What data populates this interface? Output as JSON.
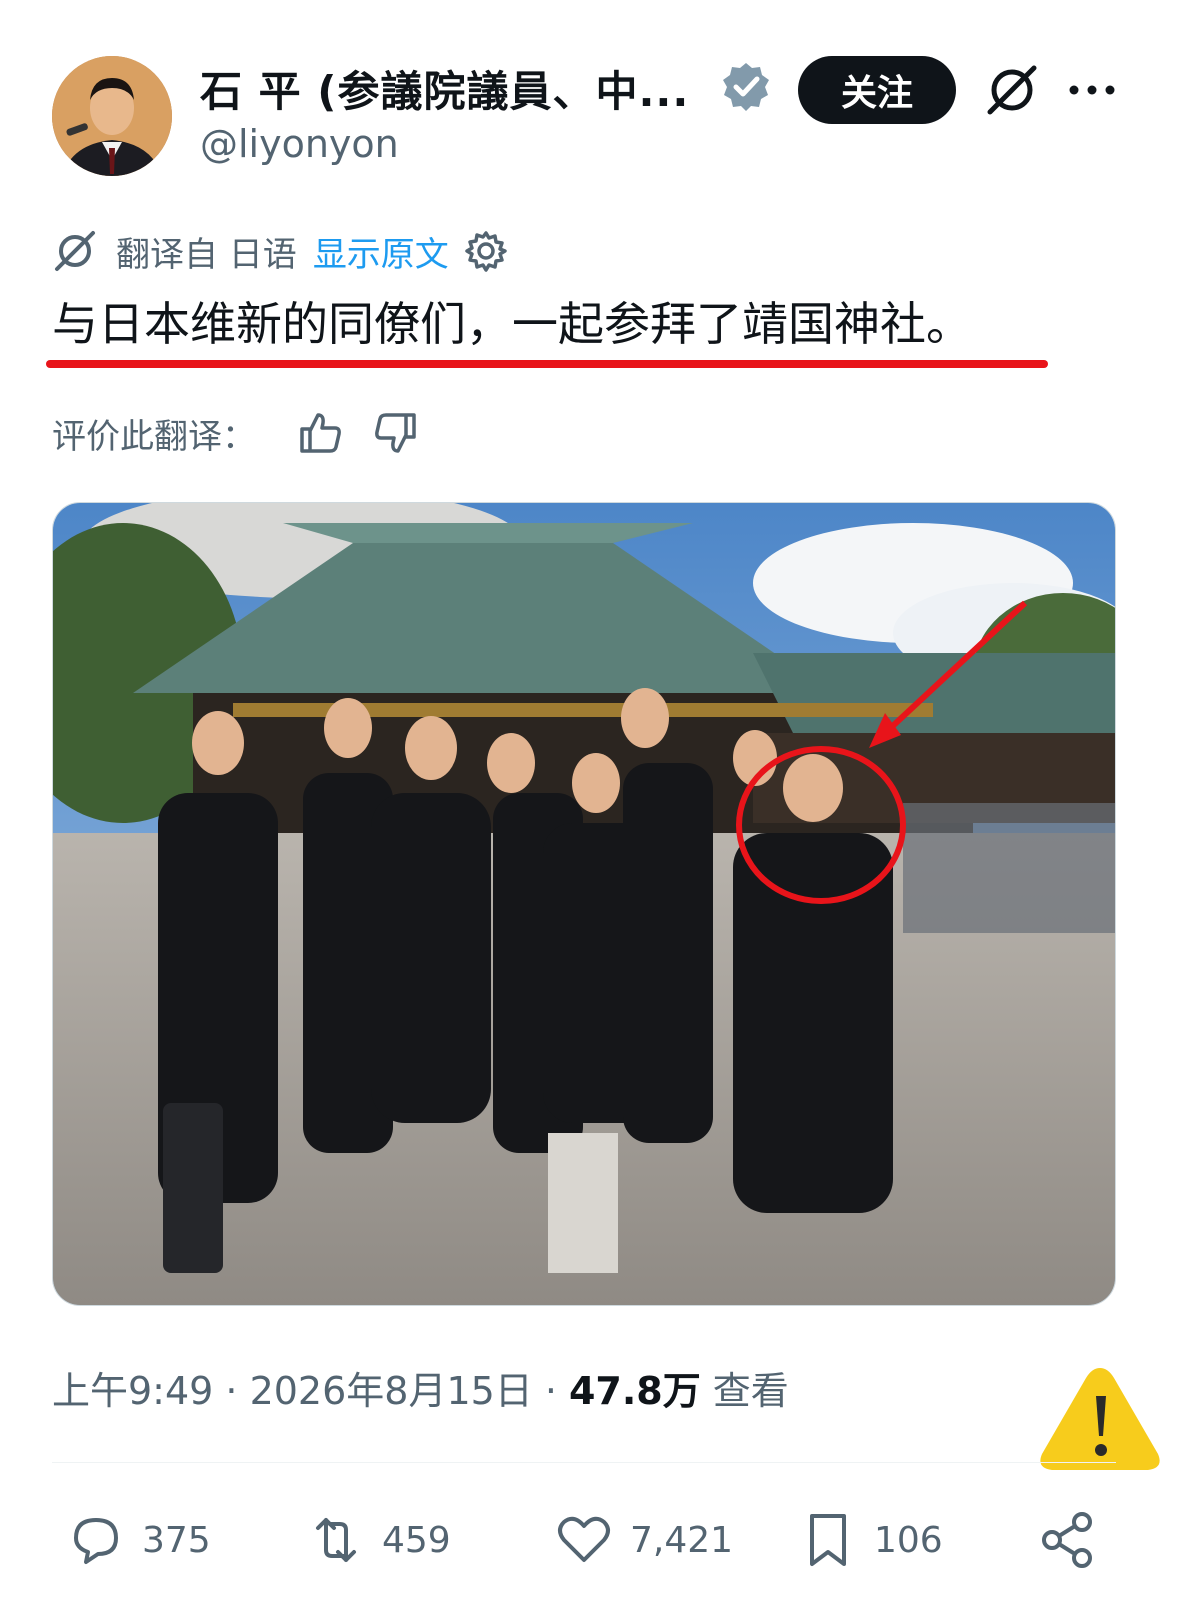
{
  "author": {
    "display_name": "石 平 (参議院議員、中...",
    "handle": "@liyonyon",
    "verified": true
  },
  "header": {
    "follow_label": "关注",
    "accent_color": "#1d9bf0"
  },
  "translation": {
    "from_label": "翻译自 日语",
    "show_original": "显示原文",
    "rate_label": "评价此翻译："
  },
  "tweet": {
    "text": "与日本维新的同僚们，一起参拜了靖国神社。",
    "highlight_color": "#e8141a"
  },
  "meta": {
    "time_date": "上午9:49 · 2026年8月15日 ·",
    "views_count": "47.8万",
    "views_label": "查看"
  },
  "actions": {
    "replies": "375",
    "retweets": "459",
    "likes": "7,421",
    "bookmarks": "106"
  },
  "icons": [
    "verified-icon",
    "grok-icon",
    "more-icon",
    "translate-icon",
    "gear-icon",
    "thumbs-up-icon",
    "thumbs-down-icon",
    "warning-icon",
    "reply-icon",
    "retweet-icon",
    "like-icon",
    "bookmark-icon",
    "share-icon"
  ]
}
